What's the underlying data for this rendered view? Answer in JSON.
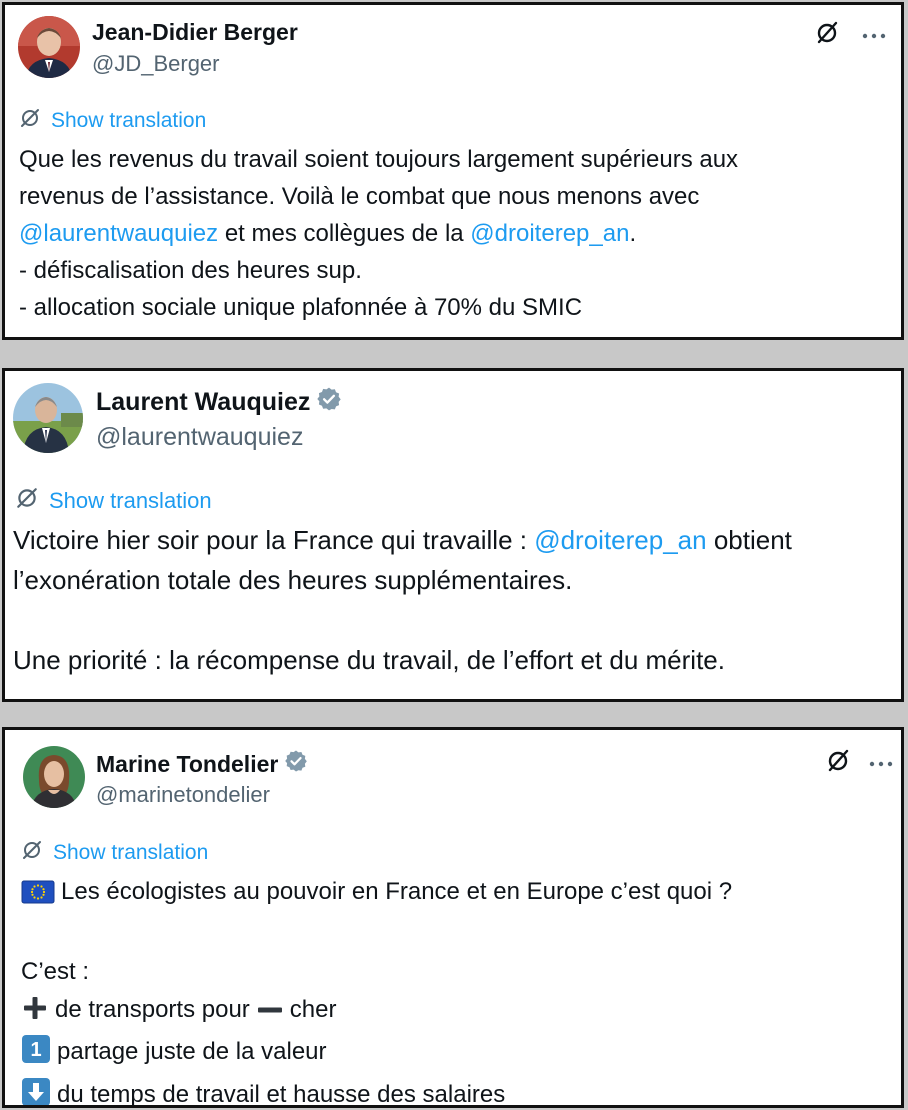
{
  "colors": {
    "link": "#1d9bf0",
    "text": "#0f1419",
    "muted": "#536471",
    "verified": "#829aab",
    "emoji_blue": "#3b88c3"
  },
  "tweets": [
    {
      "name": "Jean-Didier Berger",
      "handle": "@JD_Berger",
      "verified": false,
      "translate_label": "Show translation",
      "top_icons": [
        "grok-icon",
        "more-icon"
      ],
      "lines": [
        {
          "parts": [
            "Que les revenus du travail soient toujours largement supérieurs aux"
          ]
        },
        {
          "parts": [
            "revenus de l’assistance. Voilà le combat que nous menons avec"
          ]
        },
        {
          "parts": [
            "@laurentwauquiez",
            " et mes collègues de la ",
            "@droiterep_an",
            "."
          ]
        },
        {
          "parts": [
            "- défiscalisation des heures sup."
          ]
        },
        {
          "parts": [
            "- allocation sociale unique plafonnée à 70% du SMIC"
          ]
        }
      ]
    },
    {
      "name": "Laurent Wauquiez",
      "handle": "@laurentwauquiez",
      "verified": true,
      "translate_label": "Show translation",
      "lines": [
        {
          "parts": [
            "Victoire hier soir pour la France qui travaille : ",
            "@droiterep_an",
            " obtient"
          ]
        },
        {
          "parts": [
            "l’exonération totale des heures supplémentaires."
          ]
        },
        {
          "parts": [
            "Une priorité : la récompense du travail, de l’effort et du mérite."
          ]
        }
      ]
    },
    {
      "name": "Marine Tondelier",
      "handle": "@marinetondelier",
      "verified": true,
      "translate_label": "Show translation",
      "top_icons": [
        "grok-icon",
        "more-icon"
      ],
      "lines": [
        {
          "emoji": "eu-flag-emoji",
          "parts": [
            "Les écologistes au pouvoir en France et en Europe c’est quoi ?"
          ]
        },
        {
          "parts": [
            "C’est :"
          ]
        },
        {
          "emoji": "plus-emoji",
          "parts": [
            "de transports pour",
            "cher"
          ],
          "inline_emoji": "minus-emoji"
        },
        {
          "emoji": "keycap-1-emoji",
          "emoji_text": "1",
          "parts": [
            "partage juste de la valeur"
          ]
        },
        {
          "emoji": "down-arrow-emoji",
          "parts": [
            "du temps de travail et hausse des salaires"
          ]
        }
      ]
    }
  ]
}
